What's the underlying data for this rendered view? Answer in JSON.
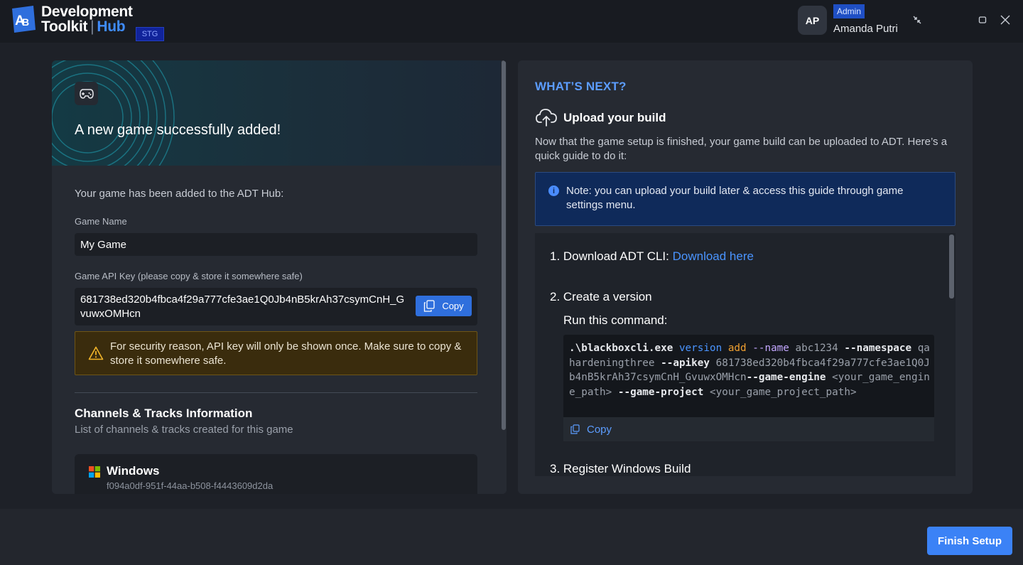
{
  "app": {
    "brand_line1": "Development",
    "brand_line2": "Toolkit",
    "brand_separator": "|",
    "brand_hub": "Hub",
    "env_badge": "STG"
  },
  "user": {
    "initials": "AP",
    "role": "Admin",
    "name": "Amanda Putri"
  },
  "window_controls": [
    "shrink-icon",
    "maximize-icon",
    "close-icon"
  ],
  "left": {
    "hero_title": "A new game successfully added!",
    "intro": "Your game has been added to the ADT Hub:",
    "game_name_label": "Game Name",
    "game_name_value": "My Game",
    "api_key_label": "Game API Key (please copy & store it somewhere safe)",
    "api_key_value": "681738ed320b4fbca4f29a777cfe3ae1Q0Jb4nB5krAh37csymCnH_GvuwxOMHcn",
    "copy_label": "Copy",
    "warning": "For security reason, API key will only be shown once. Make sure to copy & store it somewhere safe.",
    "channels_title": "Channels & Tracks Information",
    "channels_subtitle": "List of channels & tracks created for this game",
    "channels": [
      {
        "name": "Windows",
        "id": "f094a0df-951f-44aa-b508-f4443609d2da"
      }
    ]
  },
  "right": {
    "section_title": "WHAT’S NEXT?",
    "upload_title": "Upload your build",
    "guide": "Now that the game setup is finished, your game build can be uploaded to ADT. Here’s a quick guide to do it:",
    "note": "Note: you can upload your build later & access this guide through game settings menu.",
    "step1_text": "1. Download ADT CLI: ",
    "step1_link": "Download here",
    "step2_text": "2. Create a version",
    "run_text": "Run this command:",
    "code": {
      "exe": ".\\blackboxcli.exe",
      "cmd": "version",
      "sub": "add",
      "name_flag": "--name",
      "name_val": "abc1234",
      "ns_flag": "--namespace",
      "ns_val": "qahardeningthree",
      "key_flag": "--apikey",
      "key_val": "681738ed320b4fbca4f29a777cfe3ae1Q0Jb4nB5krAh37csymCnH_GvuwxOMHcn",
      "engine_flag": "--game-engine",
      "engine_val": "<your_game_engine_path>",
      "project_flag": "--game-project",
      "project_val": "<your_game_project_path>"
    },
    "code_copy_label": "Copy",
    "step3_text": "3. Register Windows Build"
  },
  "footer": {
    "finish_label": "Finish Setup"
  },
  "colors": {
    "accent": "#3b82f6",
    "link": "#4a94ff",
    "warning_bg": "#3a2c0d",
    "note_bg": "#0f2a5a"
  }
}
